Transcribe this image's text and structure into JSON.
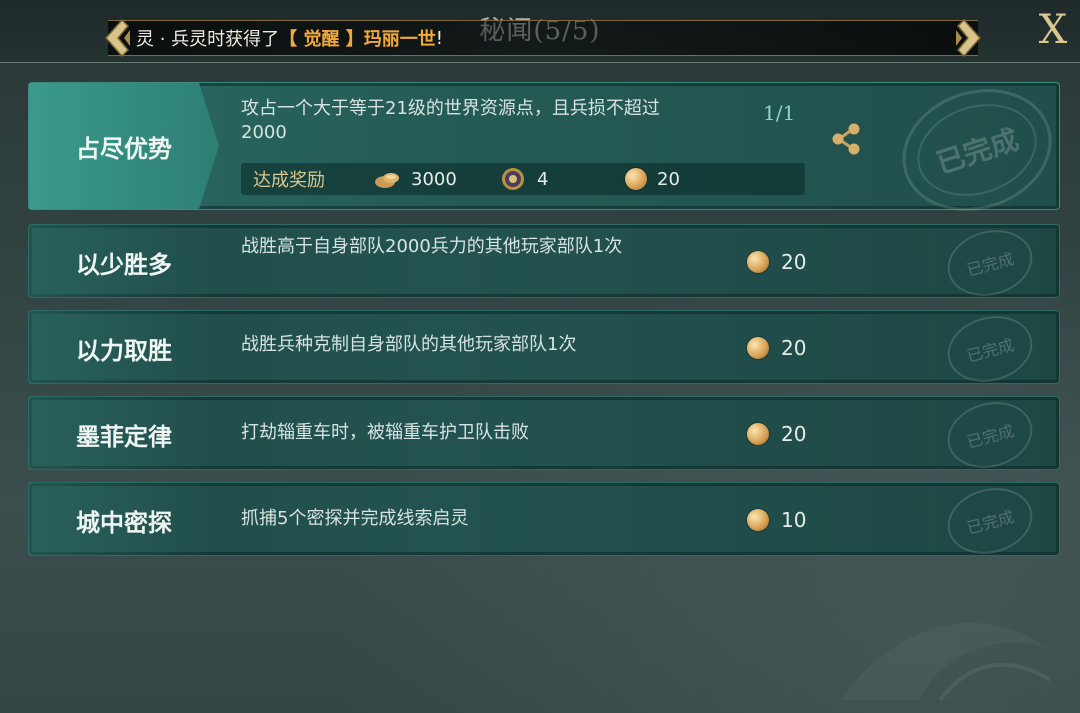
{
  "header": {
    "title": "秘闻(5/5)",
    "banner_prefix": "灵 · 兵灵时获得了",
    "banner_highlight": "【 觉醒 】玛丽一世",
    "banner_suffix": "!",
    "close_label": "X"
  },
  "featured_task": {
    "name": "占尽优势",
    "description": "攻占一个大于等于21级的世界资源点，且兵损不超过2000",
    "progress": "1/1",
    "reward_label": "达成奖励",
    "rewards": [
      {
        "icon": "bread-icon",
        "amount": "3000"
      },
      {
        "icon": "medal-icon",
        "amount": "4"
      },
      {
        "icon": "gold-coin-icon",
        "amount": "20"
      }
    ],
    "stamp": "已完成"
  },
  "tasks": [
    {
      "name": "以少胜多",
      "description": "战胜高于自身部队2000兵力的其他玩家部队1次",
      "reward": "20",
      "stamp": "已完成"
    },
    {
      "name": "以力取胜",
      "description": "战胜兵种克制自身部队的其他玩家部队1次",
      "reward": "20",
      "stamp": "已完成"
    },
    {
      "name": "墨菲定律",
      "description": "打劫辎重车时，被辎重车护卫队击败",
      "reward": "20",
      "stamp": "已完成"
    },
    {
      "name": "城中密探",
      "description": "抓捕5个密探并完成线索启灵",
      "reward": "10",
      "stamp": "已完成"
    }
  ],
  "colors": {
    "accent_gold": "#d9c78f",
    "highlight_orange": "#f2a93b",
    "panel_teal": "#235350"
  }
}
